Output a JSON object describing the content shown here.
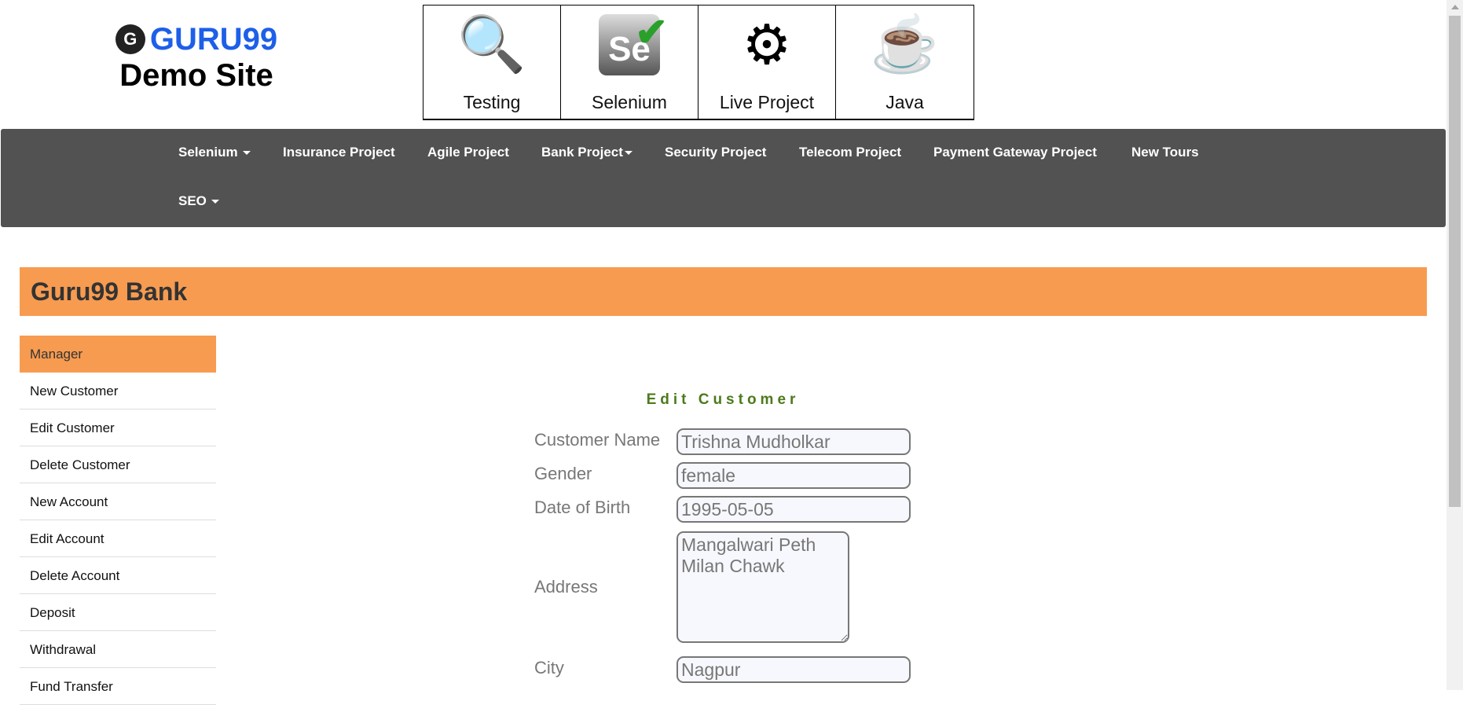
{
  "logo": {
    "brand": "GURU99",
    "subtitle": "Demo Site"
  },
  "courses": [
    {
      "label": "Testing",
      "icon": "magnifier-bug-icon"
    },
    {
      "label": "Selenium",
      "icon": "selenium-icon"
    },
    {
      "label": "Live Project",
      "icon": "gear-bulb-icon"
    },
    {
      "label": "Java",
      "icon": "java-icon"
    }
  ],
  "nav": {
    "items": [
      "Selenium",
      "Insurance Project",
      "Agile Project",
      "Bank Project",
      "Security Project",
      "Telecom Project",
      "Payment Gateway Project",
      "New Tours",
      "SEO"
    ]
  },
  "banner": {
    "title": "Guru99 Bank"
  },
  "sidebar": {
    "items": [
      "Manager",
      "New Customer",
      "Edit Customer",
      "Delete Customer",
      "New Account",
      "Edit Account",
      "Delete Account",
      "Deposit",
      "Withdrawal",
      "Fund Transfer"
    ]
  },
  "form": {
    "title": "Edit Customer",
    "fields": [
      {
        "label": "Customer Name",
        "value": "Trishna Mudholkar"
      },
      {
        "label": "Gender",
        "value": "female"
      },
      {
        "label": "Date of Birth",
        "value": "1995-05-05"
      },
      {
        "label": "Address",
        "value": "Mangalwari Peth\nMilan Chawk"
      },
      {
        "label": "City",
        "value": "Nagpur"
      }
    ]
  },
  "colors": {
    "accent": "#f79b50",
    "nav": "#525252",
    "title_green": "#4d7a1c"
  }
}
